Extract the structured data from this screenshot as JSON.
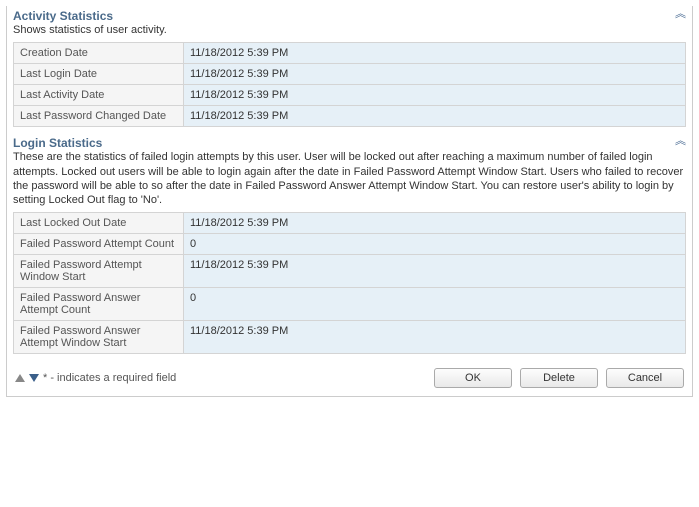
{
  "activity": {
    "title": "Activity Statistics",
    "desc": "Shows statistics of user activity.",
    "rows": [
      {
        "label": "Creation Date",
        "value": "11/18/2012 5:39 PM"
      },
      {
        "label": "Last Login Date",
        "value": "11/18/2012 5:39 PM"
      },
      {
        "label": "Last Activity Date",
        "value": "11/18/2012 5:39 PM"
      },
      {
        "label": "Last Password Changed Date",
        "value": "11/18/2012 5:39 PM"
      }
    ]
  },
  "login": {
    "title": "Login Statistics",
    "desc": "These are the statistics of failed login attempts by this user. User will be locked out after reaching a maximum number of failed login attempts. Locked out users will be able to login again after the date in Failed Password Attempt Window Start. Users who failed to recover the password will be able to so after the date in Failed Password Answer Attempt Window Start. You can restore user's ability to login by setting Locked Out flag to 'No'.",
    "rows": [
      {
        "label": "Last Locked Out Date",
        "value": "11/18/2012 5:39 PM"
      },
      {
        "label": "Failed Password Attempt Count",
        "value": "0"
      },
      {
        "label": "Failed Password Attempt Window Start",
        "value": "11/18/2012 5:39 PM"
      },
      {
        "label": "Failed Password Answer Attempt Count",
        "value": "0"
      },
      {
        "label": "Failed Password Answer Attempt Window Start",
        "value": "11/18/2012 5:39 PM"
      }
    ]
  },
  "footer": {
    "required_hint": "* - indicates a required field",
    "ok": "OK",
    "delete": "Delete",
    "cancel": "Cancel"
  }
}
